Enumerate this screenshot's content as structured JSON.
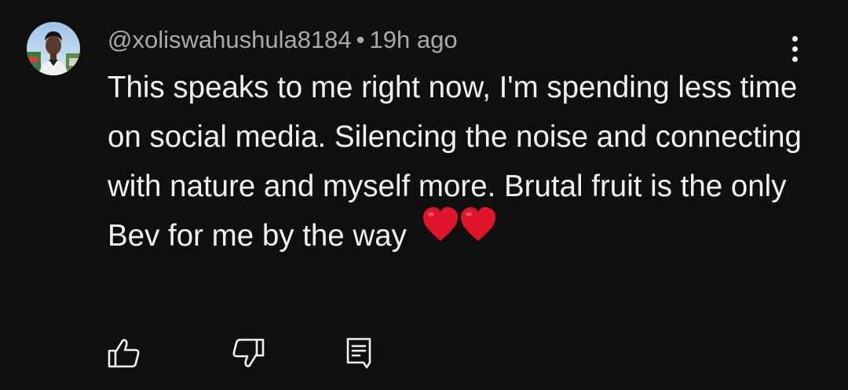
{
  "comment": {
    "author": "@xoliswahushula8184",
    "separator": "•",
    "timestamp": "19h ago",
    "text": "This speaks to me right now, I'm spending less time on social media. Silencing the noise and connecting with nature and myself more. Brutal fruit is the only Bev for me by the way",
    "emoji": "❤️❤️"
  },
  "icons": {
    "menu": "more-vert-icon",
    "like": "thumb-up-icon",
    "dislike": "thumb-down-icon",
    "reply": "reply-comment-icon"
  },
  "colors": {
    "background": "#0f0f0f",
    "text": "#f1f1f1",
    "meta": "#aaaaaa",
    "heart": "#e0142b"
  }
}
